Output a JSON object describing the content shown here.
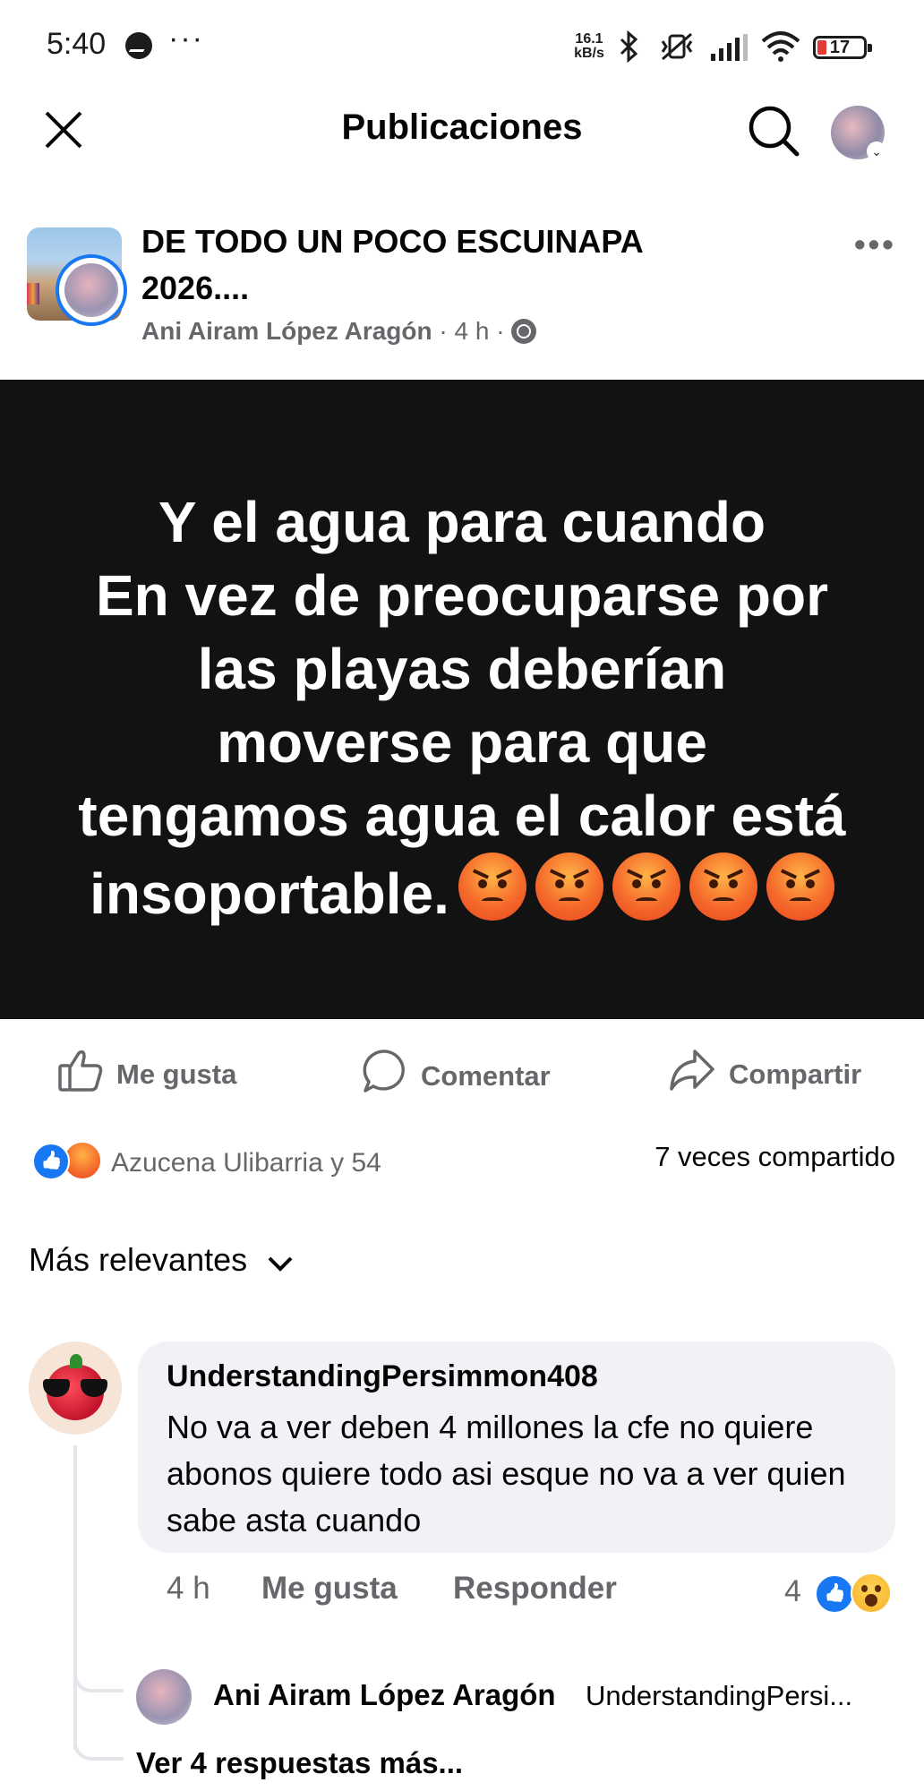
{
  "status_bar": {
    "time": "5:40",
    "overflow": "···",
    "speed_value": "16.1",
    "speed_unit": "kB/s",
    "battery": "17",
    "icons": [
      "messenger-icon",
      "bluetooth-icon",
      "vibrate-off-icon",
      "signal-icon",
      "wifi-icon",
      "battery-icon"
    ]
  },
  "header": {
    "title": "Publicaciones",
    "close_icon": "close-icon",
    "search_icon": "search-icon"
  },
  "post": {
    "group_name": "DE TODO UN POCO ESCUINAPA 2026....",
    "author": "Ani Airam López Aragón",
    "separator": "·",
    "time": "4 h",
    "privacy_icon": "globe-icon",
    "more": "•••",
    "text_lines": [
      "Y el agua para cuando",
      "En vez de preocuparse por",
      "las playas deberían",
      "moverse para que",
      "tengamos agua el calor está",
      "insoportable."
    ],
    "emoji": "angry-face-emoji"
  },
  "actions": {
    "like": "Me gusta",
    "comment": "Comentar",
    "share": "Compartir"
  },
  "reactions": {
    "summary": "Azucena Ulibarria y 54",
    "shares": "7 veces compartido",
    "colors": {
      "like": "#1877f2",
      "angry": "#f56a2b"
    }
  },
  "comments": {
    "sort_label": "Más relevantes",
    "items": [
      {
        "author": "UnderstandingPersimmon408",
        "text": "No va a ver deben 4 millones la cfe no quiere abonos quiere todo asi esque no va a ver quien sabe asta cuando",
        "time": "4 h",
        "like": "Me gusta",
        "reply": "Responder",
        "reaction_count": "4"
      }
    ],
    "reply": {
      "author": "Ani Airam López Aragón",
      "mention": "UnderstandingPersi..."
    },
    "more_replies": "Ver 4 respuestas más..."
  }
}
